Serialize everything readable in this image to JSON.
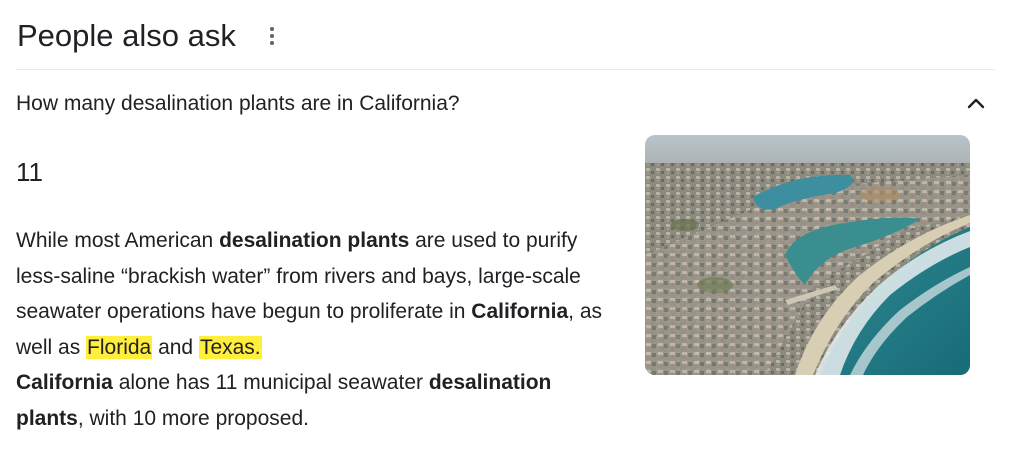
{
  "header": {
    "title": "People also ask",
    "more_icon": "more-vertical-icon"
  },
  "question": {
    "text": "How many desalination plants are in California?",
    "expand_icon": "chevron-up-icon",
    "expanded": true
  },
  "answer": {
    "short": "11",
    "snippet": {
      "s1": "While most American ",
      "b1": "desalination plants",
      "s2": " are used to purify less-saline “brackish water” from rivers and bays, large-scale seawater operations have begun to proliferate in ",
      "b2": "California",
      "s3": ", as well as ",
      "h1": "Florida",
      "s4": " and ",
      "h2": "Texas.",
      "s5": " ",
      "b3": "California",
      "s6": " alone has 11 municipal seawater ",
      "b4": "desalination plants",
      "s7": ", with 10 more proposed."
    },
    "highlight_color": "#ffef3c"
  },
  "image": {
    "description_icon": "aerial-coastline-photo"
  },
  "colors": {
    "text": "#202124",
    "divider": "#e8eaed",
    "icon": "#5f6368"
  }
}
